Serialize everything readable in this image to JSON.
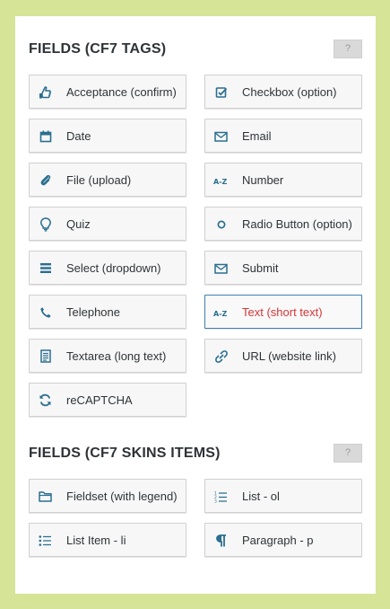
{
  "sections": [
    {
      "title": "FIELDS (CF7 TAGS)",
      "help": "?",
      "items": [
        {
          "label": "Acceptance (confirm)",
          "icon": "hand-icon"
        },
        {
          "label": "Checkbox (option)",
          "icon": "checkbox-icon"
        },
        {
          "label": "Date",
          "icon": "calendar-icon"
        },
        {
          "label": "Email",
          "icon": "envelope-icon"
        },
        {
          "label": "File (upload)",
          "icon": "paperclip-icon"
        },
        {
          "label": "Number",
          "icon": "a-z-icon"
        },
        {
          "label": "Quiz",
          "icon": "lightbulb-icon"
        },
        {
          "label": "Radio Button (option)",
          "icon": "radio-circle-icon"
        },
        {
          "label": "Select (dropdown)",
          "icon": "menu-lines-icon"
        },
        {
          "label": "Submit",
          "icon": "envelope-icon"
        },
        {
          "label": "Telephone",
          "icon": "phone-icon"
        },
        {
          "label": "Text (short text)",
          "icon": "a-z-icon",
          "active": true
        },
        {
          "label": "Textarea (long text)",
          "icon": "document-icon"
        },
        {
          "label": "URL (website link)",
          "icon": "link-icon"
        },
        {
          "label": "reCAPTCHA",
          "icon": "refresh-icon"
        }
      ]
    },
    {
      "title": "FIELDS (CF7 SKINS ITEMS)",
      "help": "?",
      "items": [
        {
          "label": "Fieldset (with legend)",
          "icon": "folder-icon"
        },
        {
          "label": "List - ol",
          "icon": "ordered-list-icon"
        },
        {
          "label": "List Item - li",
          "icon": "unordered-list-icon"
        },
        {
          "label": "Paragraph - p",
          "icon": "pilcrow-icon"
        }
      ]
    }
  ],
  "colors": {
    "background": "#d5e497",
    "panel": "#ffffff",
    "icon": "#2a6f8f",
    "active_border": "#3e7fb1",
    "active_text": "#d63638",
    "text": "#2f3337"
  }
}
